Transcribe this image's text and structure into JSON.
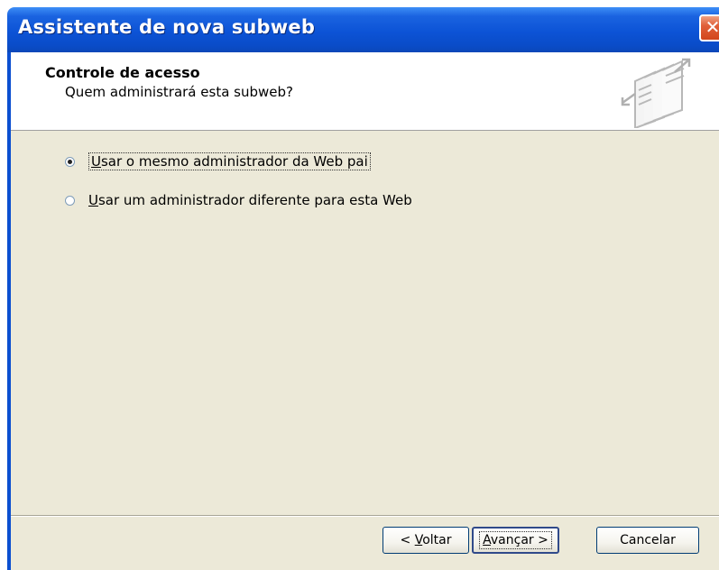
{
  "window": {
    "title": "Assistente de nova subweb",
    "close_glyph": "✕"
  },
  "header": {
    "title": "Controle de acesso",
    "subtitle": "Quem administrará esta subweb?",
    "icon": "wizard-pages-icon"
  },
  "options": [
    {
      "label": "Usar o mesmo administrador da Web pai",
      "accesskey": "U",
      "selected": true
    },
    {
      "label": "Usar um administrador diferente para esta Web",
      "accesskey": "U",
      "selected": false
    }
  ],
  "buttons": {
    "back": {
      "label_prefix": "< ",
      "accesskey": "V",
      "label_rest": "oltar"
    },
    "next": {
      "accesskey": "A",
      "label_rest": "vançar",
      "label_suffix": " >"
    },
    "cancel": {
      "label": "Cancelar"
    }
  },
  "colors": {
    "titlebar": "#0c53d6",
    "dialog_bg": "#ece9d8",
    "close": "#d2461c"
  }
}
